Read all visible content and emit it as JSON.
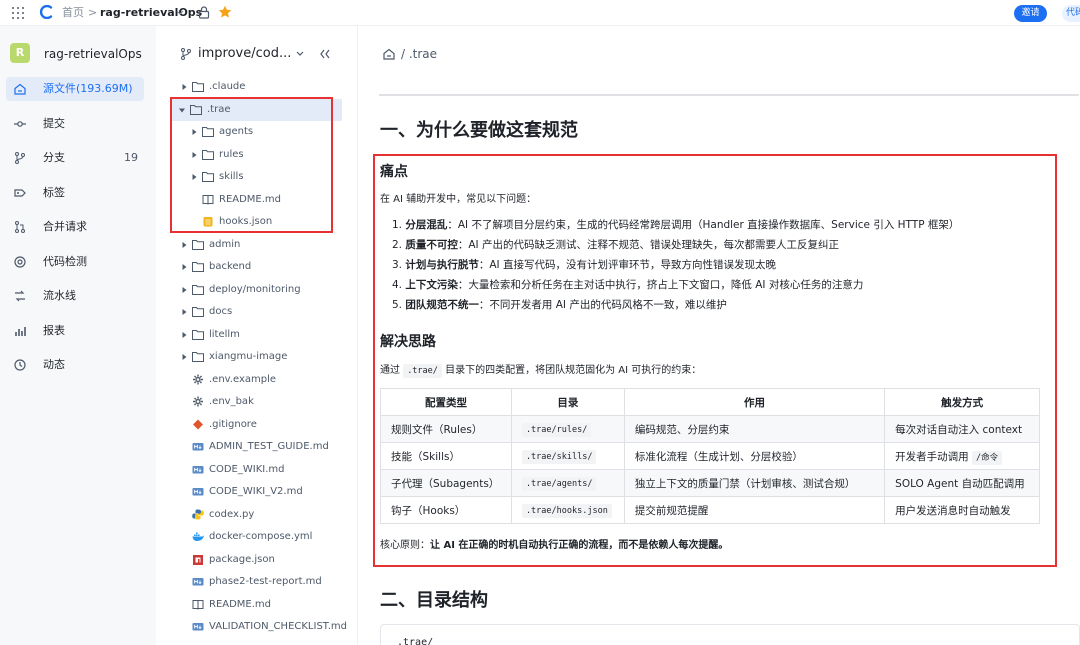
{
  "topbar": {
    "home": "首页",
    "separator": ">",
    "repo": "rag-retrievalOps",
    "invite_label": "邀请",
    "code_label": "代码"
  },
  "leftnav": {
    "avatar_letter": "R",
    "project_name": "rag-retrievalOps",
    "items": [
      {
        "label": "源文件(193.69M)",
        "icon": "home-icon",
        "active": true
      },
      {
        "label": "提交",
        "icon": "commit-icon"
      },
      {
        "label": "分支",
        "icon": "branch-icon",
        "count": "19"
      },
      {
        "label": "标签",
        "icon": "tag-icon"
      },
      {
        "label": "合并请求",
        "icon": "merge-request-icon"
      },
      {
        "label": "代码检测",
        "icon": "code-scan-icon"
      },
      {
        "label": "流水线",
        "icon": "pipeline-icon"
      },
      {
        "label": "报表",
        "icon": "report-icon"
      },
      {
        "label": "动态",
        "icon": "activity-icon"
      }
    ]
  },
  "tree": {
    "branch": "improve/cod...",
    "items": [
      {
        "name": ".claude",
        "type": "folder",
        "expanded": false
      },
      {
        "name": ".trae",
        "type": "folder",
        "expanded": true,
        "selected": true
      },
      {
        "name": "agents",
        "type": "folder"
      },
      {
        "name": "rules",
        "type": "folder"
      },
      {
        "name": "skills",
        "type": "folder"
      },
      {
        "name": "README.md",
        "type": "book"
      },
      {
        "name": "hooks.json",
        "type": "json"
      },
      {
        "name": "admin",
        "type": "folder"
      },
      {
        "name": "backend",
        "type": "folder"
      },
      {
        "name": "deploy/monitoring",
        "type": "folder"
      },
      {
        "name": "docs",
        "type": "folder"
      },
      {
        "name": "litellm",
        "type": "folder"
      },
      {
        "name": "xiangmu-image",
        "type": "folder"
      },
      {
        "name": ".env.example",
        "type": "gear"
      },
      {
        "name": ".env_bak",
        "type": "gear"
      },
      {
        "name": ".gitignore",
        "type": "git"
      },
      {
        "name": "ADMIN_TEST_GUIDE.md",
        "type": "md"
      },
      {
        "name": "CODE_WIKI.md",
        "type": "md"
      },
      {
        "name": "CODE_WIKI_V2.md",
        "type": "md"
      },
      {
        "name": "codex.py",
        "type": "python"
      },
      {
        "name": "docker-compose.yml",
        "type": "docker"
      },
      {
        "name": "package.json",
        "type": "npm"
      },
      {
        "name": "phase2-test-report.md",
        "type": "md"
      },
      {
        "name": "README.md",
        "type": "book"
      },
      {
        "name": "VALIDATION_CHECKLIST.md",
        "type": "md"
      }
    ]
  },
  "content": {
    "breadcrumb": "/ .trae",
    "section1_title": "一、为什么要做这套规范",
    "pain_title": "痛点",
    "pain_intro": "在 AI 辅助开发中，常见以下问题：",
    "pain_items": [
      {
        "num": "1.",
        "bold": "分层混乱",
        "text": "：AI 不了解项目分层约束，生成的代码经常跨层调用（Handler 直接操作数据库、Service 引入 HTTP 框架）"
      },
      {
        "num": "2.",
        "bold": "质量不可控",
        "text": "：AI 产出的代码缺乏测试、注释不规范、错误处理缺失，每次都需要人工反复纠正"
      },
      {
        "num": "3.",
        "bold": "计划与执行脱节",
        "text": "：AI 直接写代码，没有计划评审环节，导致方向性错误发现太晚"
      },
      {
        "num": "4.",
        "bold": "上下文污染",
        "text": "：大量检索和分析任务在主对话中执行，挤占上下文窗口，降低 AI 对核心任务的注意力"
      },
      {
        "num": "5.",
        "bold": "团队规范不统一",
        "text": "：不同开发者用 AI 产出的代码风格不一致，难以维护"
      }
    ],
    "solution_title": "解决思路",
    "solution_pre": "通过",
    "solution_code": ".trae/",
    "solution_post": "目录下的四类配置，将团队规范固化为 AI 可执行的约束：",
    "table": {
      "headers": [
        "配置类型",
        "目录",
        "作用",
        "触发方式"
      ],
      "rows": [
        {
          "type": "规则文件（Rules）",
          "dir": ".trae/rules/",
          "role": "编码规范、分层约束",
          "trigger": "每次对话自动注入 context",
          "trigger_code": ""
        },
        {
          "type": "技能（Skills）",
          "dir": ".trae/skills/",
          "role": "标准化流程（生成计划、分层校验）",
          "trigger": "开发者手动调用",
          "trigger_code": "/命令"
        },
        {
          "type": "子代理（Subagents）",
          "dir": ".trae/agents/",
          "role": "独立上下文的质量门禁（计划审核、测试合规）",
          "trigger": "SOLO Agent 自动匹配调用",
          "trigger_code": ""
        },
        {
          "type": "钩子（Hooks）",
          "dir": ".trae/hooks.json",
          "role": "提交前规范提醒",
          "trigger": "用户发送消息时自动触发",
          "trigger_code": ""
        }
      ]
    },
    "core_label": "核心原则：",
    "core_bold": "让 AI 在正确的时机自动执行正确的流程，而不是依赖人每次提醒。",
    "section2_title": "二、目录结构",
    "code_first_line": ".trae/"
  }
}
